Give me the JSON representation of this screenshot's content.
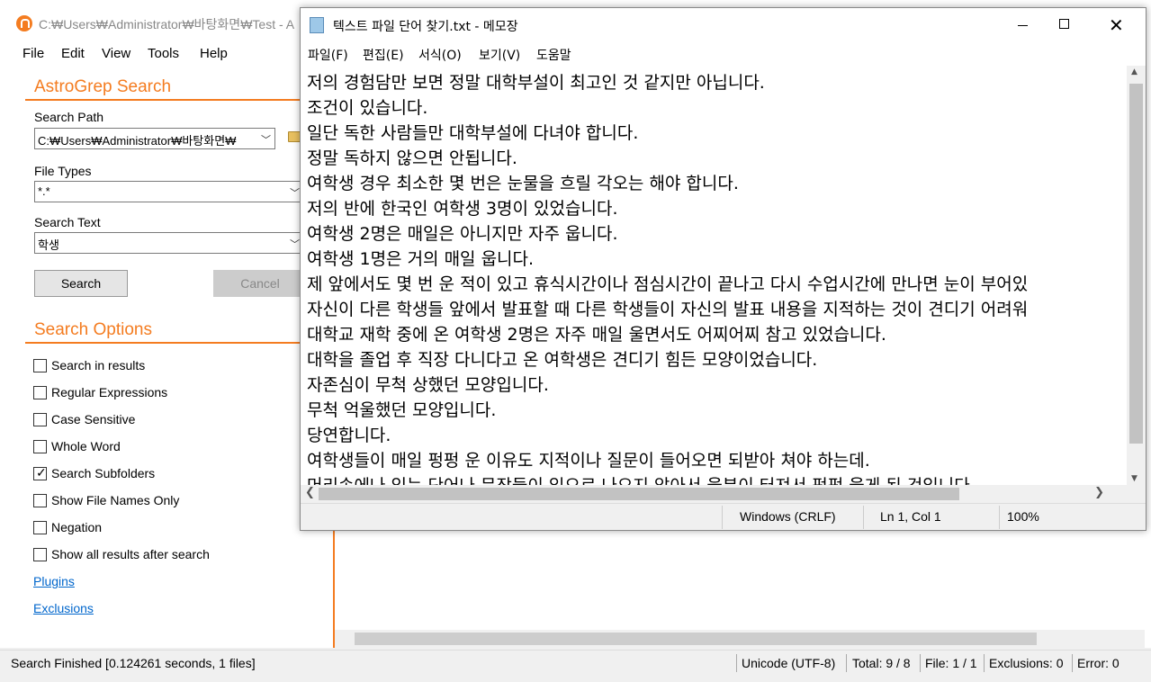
{
  "astrogrep": {
    "window_title": "C:₩Users₩Administrator₩바탕화면₩Test - A",
    "menu": [
      "File",
      "Edit",
      "View",
      "Tools",
      "Help"
    ],
    "search_header": "AstroGrep Search",
    "search_path_label": "Search Path",
    "search_path_value": "C:₩Users₩Administrator₩바탕화면₩",
    "file_types_label": "File Types",
    "file_types_value": "*.*",
    "search_text_label": "Search Text",
    "search_text_value": "학생",
    "search_button": "Search",
    "cancel_button": "Cancel",
    "options_header": "Search Options",
    "options": [
      {
        "label": "Search in results",
        "checked": false
      },
      {
        "label": "Regular Expressions",
        "checked": false
      },
      {
        "label": "Case Sensitive",
        "checked": false
      },
      {
        "label": "Whole Word",
        "checked": false
      },
      {
        "label": "Search Subfolders",
        "checked": true
      },
      {
        "label": "Show File Names Only",
        "checked": false
      },
      {
        "label": "Negation",
        "checked": false
      },
      {
        "label": "Show all results after search",
        "checked": false
      }
    ],
    "links": [
      "Plugins",
      "Exclusions"
    ],
    "status": {
      "message": "Search Finished [0.124261 seconds, 1 files]",
      "encoding": "Unicode (UTF-8)",
      "total": "Total: 9 / 8",
      "file": "File: 1 / 1",
      "exclusions": "Exclusions: 0",
      "error": "Error: 0"
    }
  },
  "notepad": {
    "title": "텍스트 파일 단어 찾기.txt - 메모장",
    "menu": [
      "파일(F)",
      "편집(E)",
      "서식(O)",
      "보기(V)",
      "도움말"
    ],
    "lines": [
      "저의 경험담만 보면 정말 대학부설이 최고인 것 같지만 아닙니다.",
      "조건이 있습니다.",
      "일단 독한 사람들만 대학부설에 다녀야 합니다.",
      "정말 독하지 않으면 안됩니다.",
      "여학생 경우 최소한 몇 번은 눈물을 흐릴 각오는 해야 합니다.",
      "저의 반에 한국인 여학생 3명이 있었습니다.",
      "여학생 2명은 매일은 아니지만 자주 웁니다.",
      "여학생 1명은 거의 매일 웁니다.",
      "제 앞에서도 몇 번 운 적이 있고 휴식시간이나 점심시간이 끝나고 다시 수업시간에 만나면 눈이 부어있",
      "자신이 다른 학생들 앞에서 발표할 때 다른 학생들이 자신의 발표 내용을 지적하는 것이 견디기 어려워",
      "대학교 재학 중에 온 여학생 2명은 자주 매일 울면서도 어찌어찌 참고 있었습니다.",
      "대학을 졸업 후 직장 다니다고 온 여학생은 견디기 힘든 모양이었습니다.",
      "자존심이 무척 상했던 모양입니다.",
      "무척 억울했던 모양입니다.",
      "당연합니다.",
      "여학생들이 매일 펑펑 운 이유도 지적이나 질문이 들어오면 되받아 쳐야 하는데.",
      "머리속에나 있는 단어나 문장들이 입으로 나오지 않아서 울분이 터져서 펑펑 울게 된 것입니다."
    ],
    "status": {
      "eol": "Windows (CRLF)",
      "position": "Ln 1, Col 1",
      "zoom": "100%"
    }
  }
}
